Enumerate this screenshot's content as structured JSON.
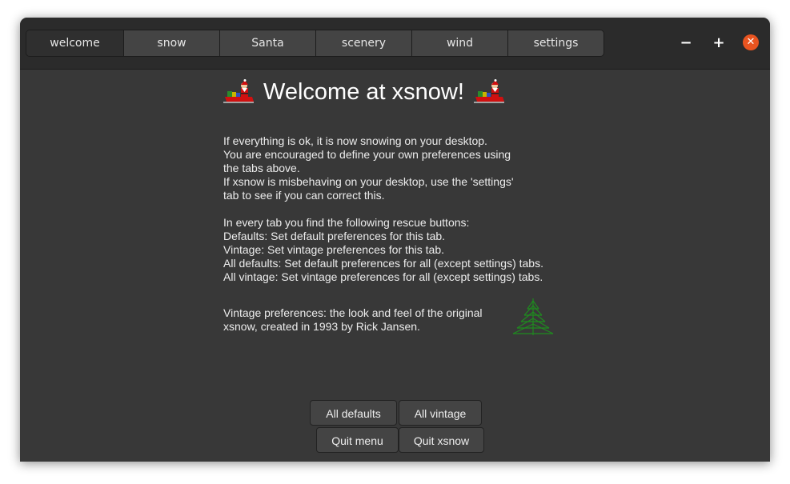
{
  "tabs": [
    {
      "label": "welcome"
    },
    {
      "label": "snow"
    },
    {
      "label": "Santa"
    },
    {
      "label": "scenery"
    },
    {
      "label": "wind"
    },
    {
      "label": "settings"
    }
  ],
  "window_controls": {
    "minimize": "−",
    "maximize": "+",
    "close": "✕"
  },
  "title": "Welcome at xsnow!",
  "intro_lines": [
    "If everything is ok, it is now snowing on your desktop.",
    "You are encouraged to define your own preferences using",
    "the tabs above.",
    "If xsnow is misbehaving on your desktop, use the 'settings'",
    "tab to see if you can correct this."
  ],
  "rescue_lines": [
    "In every tab you find the following rescue buttons:",
    "Defaults: Set default preferences for this tab.",
    "Vintage: Set vintage preferences for this tab.",
    "All defaults: Set default preferences for all (except settings) tabs.",
    "All vintage: Set vintage preferences for all (except settings) tabs."
  ],
  "vintage_lines": [
    "Vintage preferences: the look and feel of the original",
    "xsnow, created in 1993 by Rick Jansen."
  ],
  "buttons": {
    "all_defaults": "All defaults",
    "all_vintage": "All vintage",
    "quit_menu": "Quit menu",
    "quit_xsnow": "Quit xsnow"
  },
  "colors": {
    "accent_close": "#e95420",
    "tree": "#1f8a1f",
    "santa_red": "#d01010"
  },
  "icons": [
    "santa-sleigh-icon",
    "christmas-tree-icon"
  ]
}
